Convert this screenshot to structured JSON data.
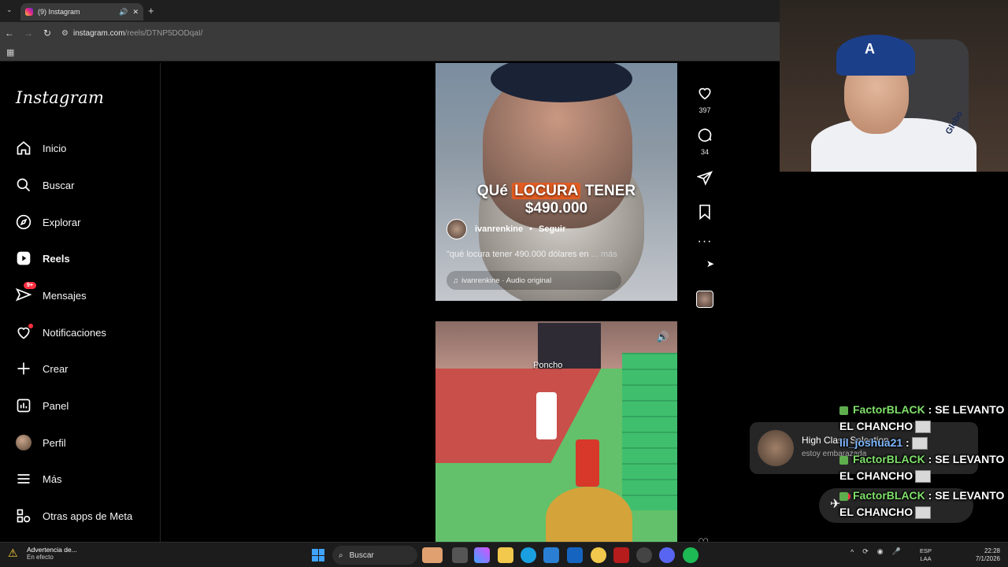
{
  "browser": {
    "tab_title": "(9) Instagram",
    "url_site": "instagram.com",
    "url_path": "/reels/DTNP5DODqaI/"
  },
  "sidebar": {
    "logo": "Instagram",
    "items": [
      {
        "label": "Inicio",
        "icon": "home-icon"
      },
      {
        "label": "Buscar",
        "icon": "search-icon"
      },
      {
        "label": "Explorar",
        "icon": "compass-icon"
      },
      {
        "label": "Reels",
        "icon": "reels-icon"
      },
      {
        "label": "Mensajes",
        "icon": "messenger-icon",
        "badge": "9+"
      },
      {
        "label": "Notificaciones",
        "icon": "heart-icon"
      },
      {
        "label": "Crear",
        "icon": "plus-icon"
      },
      {
        "label": "Panel",
        "icon": "chart-icon"
      },
      {
        "label": "Perfil",
        "icon": "avatar"
      },
      {
        "label": "Más",
        "icon": "menu-icon"
      },
      {
        "label": "Otras apps de Meta",
        "icon": "meta-apps-icon"
      }
    ]
  },
  "reel1": {
    "overlay_line1_a": "QUé",
    "overlay_line1_hl": "LOCURA",
    "overlay_line1_b": "TENER",
    "overlay_line2": "$490.000",
    "author": "ivanrenkine",
    "follow": "Seguir",
    "caption": "\"qué locura tener 490.000 dólares en",
    "more": "... más",
    "audio": "ivanrenkine · Audio original",
    "likes": "397",
    "comments": "34"
  },
  "reel2": {
    "player_label": "Poncho"
  },
  "notification": {
    "title": "High Class Selection",
    "subtitle": "estoy embarazada"
  },
  "messages_fab": {
    "badge": "9+"
  },
  "chat": [
    {
      "user": "FactorBLACK",
      "text": " : SE LEVANTO",
      "text2": "EL CHANCHO"
    },
    {
      "user": "lil_joshua21",
      "text": " :",
      "text2": ""
    },
    {
      "user": "FactorBLACK",
      "text": " : SE LEVANTO",
      "text2": "EL CHANCHO"
    },
    {
      "user": "FactorBLACK",
      "text": " : SE LEVANTO",
      "text2": "EL CHANCHO"
    }
  ],
  "webcam": {
    "cap_logo": "A",
    "shirt_text": "Globo"
  },
  "taskbar": {
    "warning_title": "Advertencia de...",
    "warning_sub": "En efecto",
    "search": "Buscar",
    "lang1": "ESP",
    "lang2": "LAA",
    "time": "22:28",
    "date": "7/1/2026"
  },
  "colors": {
    "accent_red": "#ff3040",
    "overlay_highlight": "#e35d22",
    "chat_user_green": "#7fe06a"
  }
}
